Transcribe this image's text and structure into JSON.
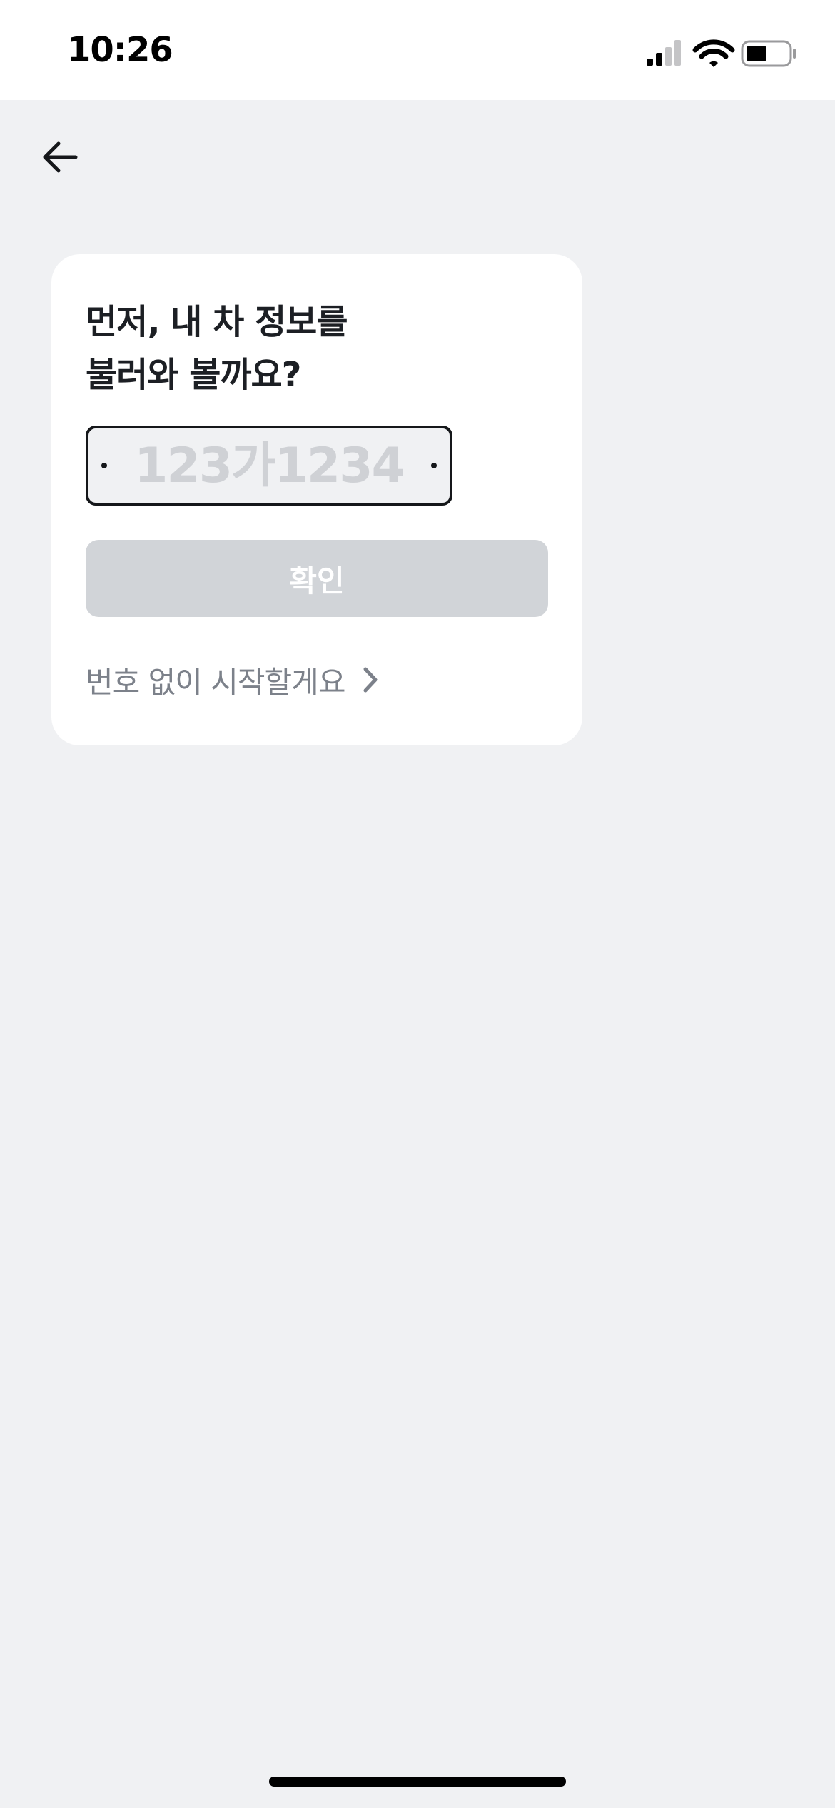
{
  "status_bar": {
    "time": "10:26",
    "icons": [
      "cellular-signal-icon",
      "wifi-icon",
      "battery-icon"
    ]
  },
  "header": {
    "back_icon": "arrow-left-icon"
  },
  "card": {
    "title_line1": "먼저, 내 차 정보를",
    "title_line2": "불러와 볼까요?",
    "plate_input": {
      "value": "",
      "placeholder": "123가1234"
    },
    "confirm_label": "확인",
    "skip_label": "번호 없이 시작할게요",
    "skip_icon": "chevron-right-icon"
  },
  "colors": {
    "background": "#f0f1f3",
    "card": "#ffffff",
    "button_disabled": "#d1d4d8",
    "text_primary": "#1c1f24",
    "text_secondary": "#7c818a"
  }
}
